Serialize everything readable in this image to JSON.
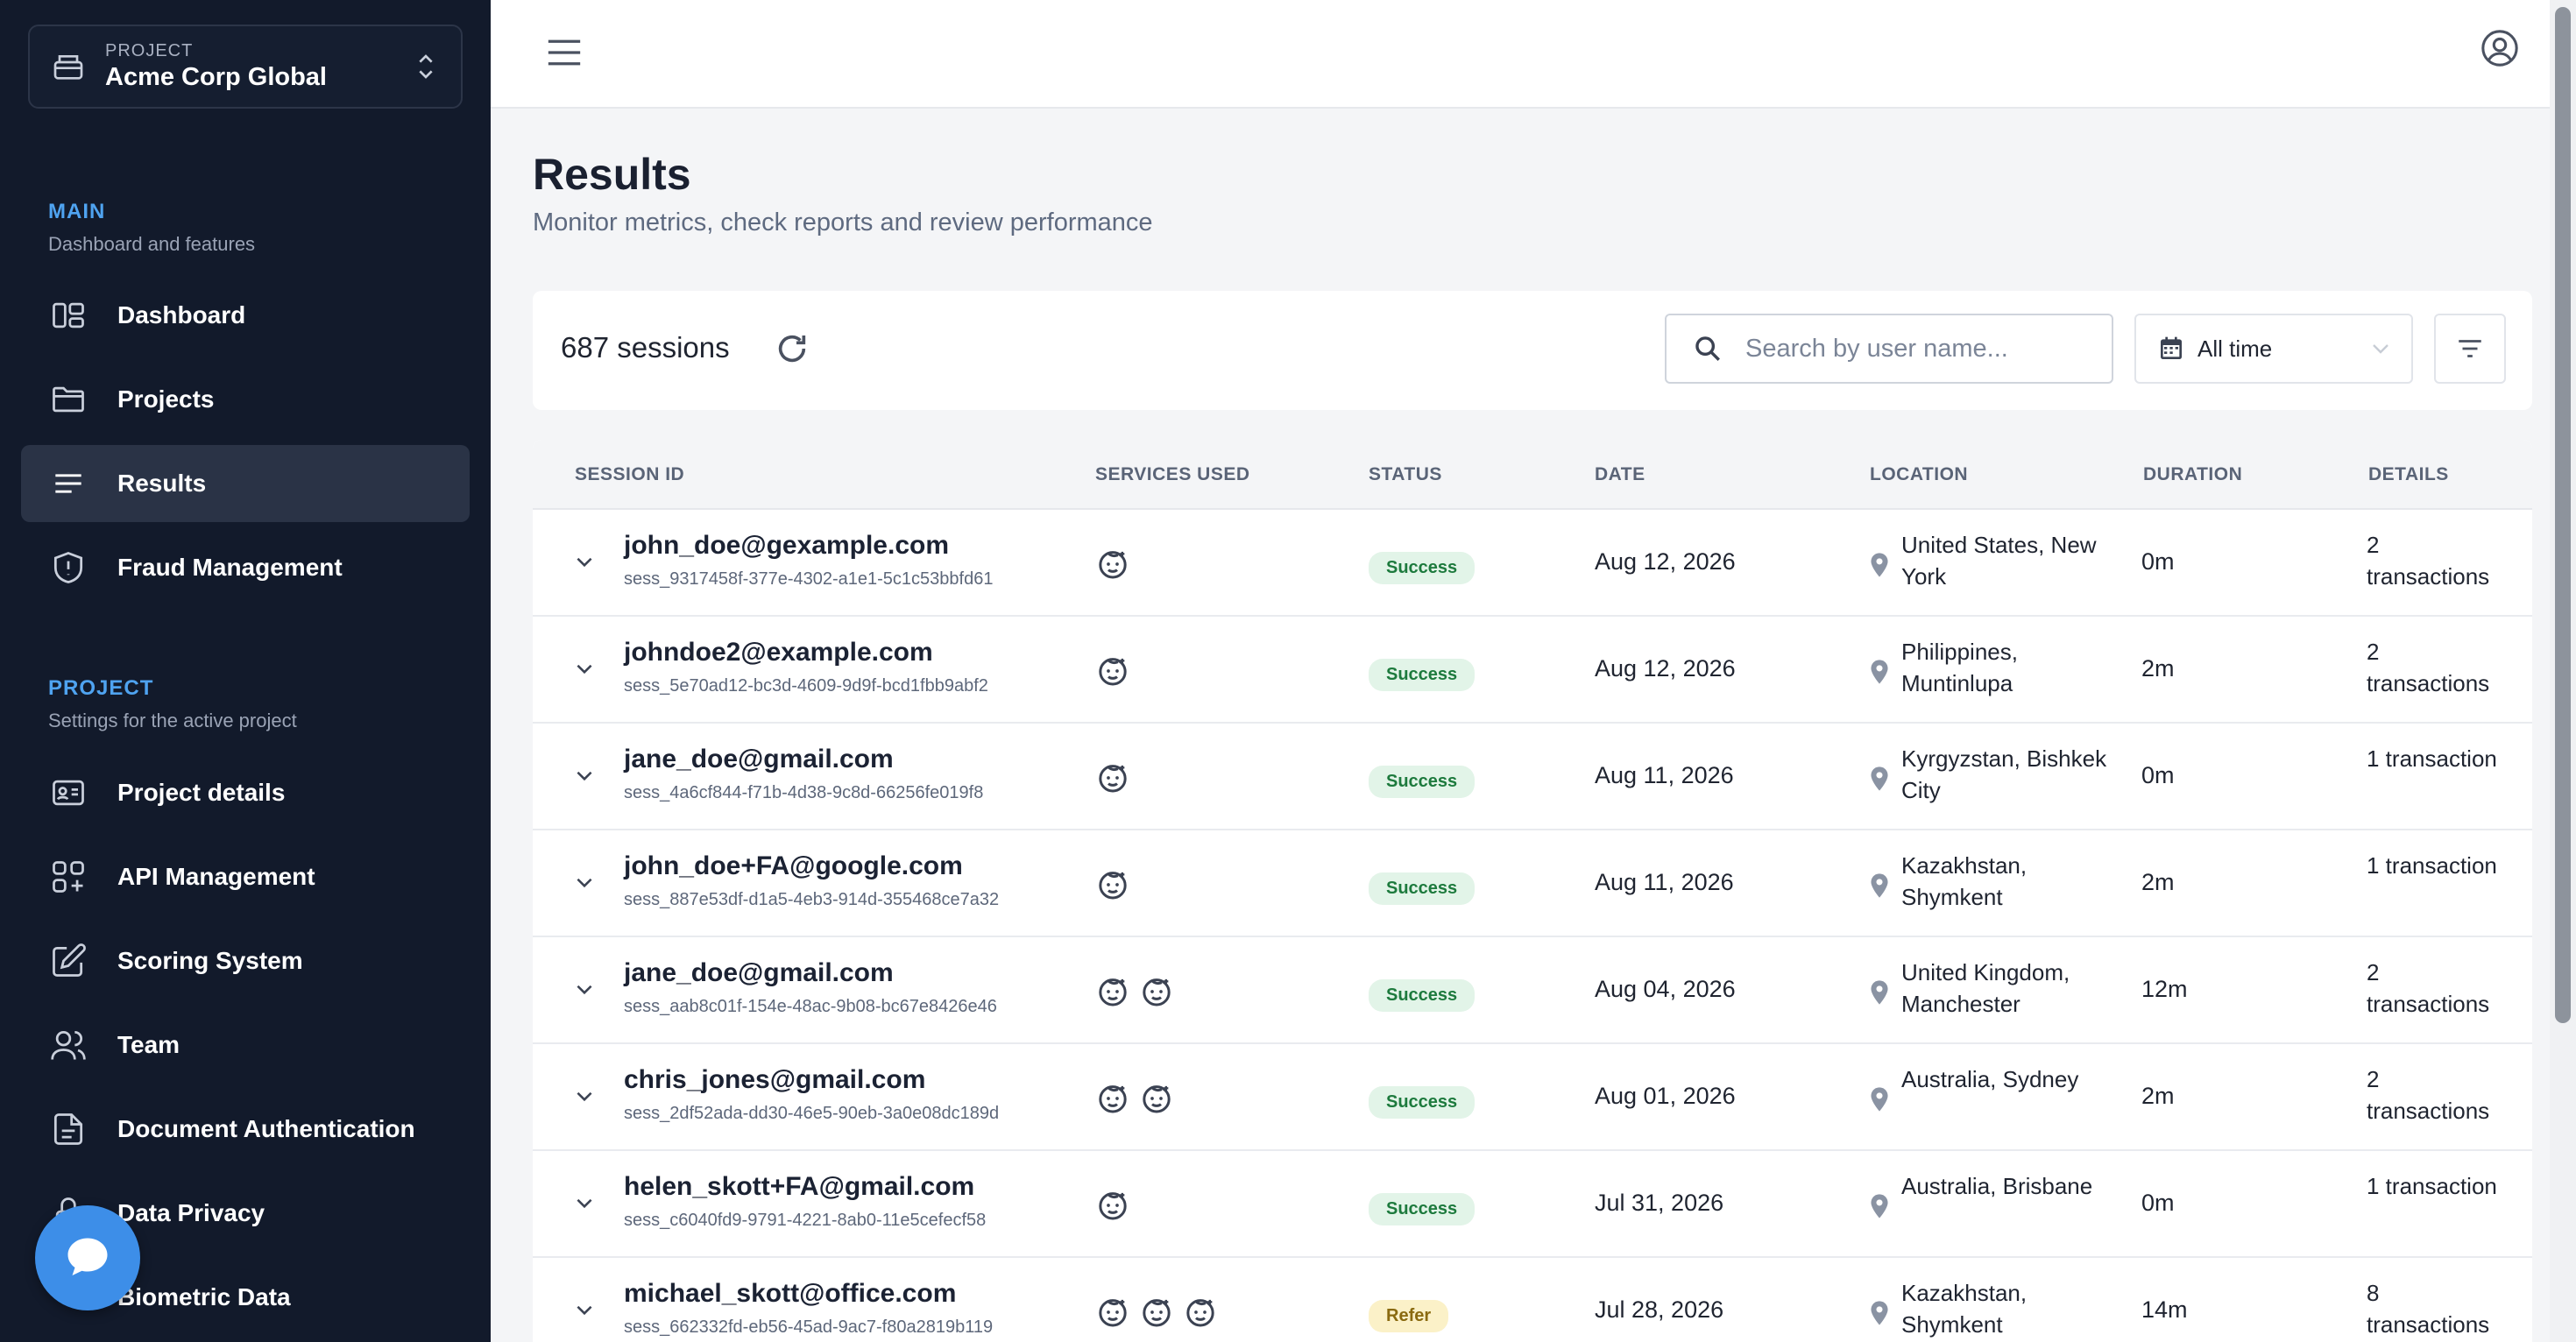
{
  "sidebar": {
    "project_label": "PROJECT",
    "project_name": "Acme Corp Global",
    "main_section": {
      "title": "MAIN",
      "subtitle": "Dashboard and features"
    },
    "main_items": [
      {
        "label": "Dashboard",
        "icon": "dashboard-icon"
      },
      {
        "label": "Projects",
        "icon": "folder-icon"
      },
      {
        "label": "Results",
        "icon": "list-icon",
        "active": true
      },
      {
        "label": "Fraud Management",
        "icon": "shield-icon"
      }
    ],
    "project_section": {
      "title": "PROJECT",
      "subtitle": "Settings for the active project"
    },
    "project_items": [
      {
        "label": "Project details",
        "icon": "id-card-icon"
      },
      {
        "label": "API Management",
        "icon": "api-grid-icon"
      },
      {
        "label": "Scoring System",
        "icon": "edit-icon"
      },
      {
        "label": "Team",
        "icon": "users-icon"
      },
      {
        "label": "Document Authentication",
        "icon": "document-icon"
      },
      {
        "label": "Data Privacy",
        "icon": "lock-icon"
      },
      {
        "label": "Biometric Data",
        "icon": "fingerprint-icon"
      }
    ]
  },
  "header": {
    "menu_icon": "hamburger-icon",
    "user_icon": "user-circle-icon"
  },
  "page": {
    "title": "Results",
    "subtitle": "Monitor metrics, check reports and review performance"
  },
  "toolbar": {
    "sessions_count": "687 sessions",
    "search_placeholder": "Search by user name...",
    "date_filter": "All time"
  },
  "table": {
    "columns": [
      "SESSION ID",
      "SERVICES USED",
      "STATUS",
      "DATE",
      "LOCATION",
      "DURATION",
      "DETAILS"
    ],
    "rows": [
      {
        "email": "john_doe@gexample.com",
        "session": "sess_9317458f-377e-4302-a1e1-5c1c53bbfd61",
        "services": 1,
        "status": "Success",
        "status_type": "success",
        "date": "Aug 12, 2026",
        "location": "United States, New York",
        "duration": "0m",
        "details": "2 transactions"
      },
      {
        "email": "johndoe2@example.com",
        "session": "sess_5e70ad12-bc3d-4609-9d9f-bcd1fbb9abf2",
        "services": 1,
        "status": "Success",
        "status_type": "success",
        "date": "Aug 12, 2026",
        "location": "Philippines, Muntinlupa",
        "duration": "2m",
        "details": "2 transactions"
      },
      {
        "email": "jane_doe@gmail.com",
        "session": "sess_4a6cf844-f71b-4d38-9c8d-66256fe019f8",
        "services": 1,
        "status": "Success",
        "status_type": "success",
        "date": "Aug 11, 2026",
        "location": "Kyrgyzstan, Bishkek City",
        "duration": "0m",
        "details": "1 transaction"
      },
      {
        "email": "john_doe+FA@google.com",
        "session": "sess_887e53df-d1a5-4eb3-914d-355468ce7a32",
        "services": 1,
        "status": "Success",
        "status_type": "success",
        "date": "Aug 11, 2026",
        "location": "Kazakhstan, Shymkent",
        "duration": "2m",
        "details": "1 transaction"
      },
      {
        "email": "jane_doe@gmail.com",
        "session": "sess_aab8c01f-154e-48ac-9b08-bc67e8426e46",
        "services": 2,
        "status": "Success",
        "status_type": "success",
        "date": "Aug 04, 2026",
        "location": "United Kingdom, Manchester",
        "duration": "12m",
        "details": "2 transactions"
      },
      {
        "email": "chris_jones@gmail.com",
        "session": "sess_2df52ada-dd30-46e5-90eb-3a0e08dc189d",
        "services": 2,
        "status": "Success",
        "status_type": "success",
        "date": "Aug 01, 2026",
        "location": "Australia, Sydney",
        "duration": "2m",
        "details": "2 transactions"
      },
      {
        "email": "helen_skott+FA@gmail.com",
        "session": "sess_c6040fd9-9791-4221-8ab0-11e5cefecf58",
        "services": 1,
        "status": "Success",
        "status_type": "success",
        "date": "Jul 31, 2026",
        "location": "Australia, Brisbane",
        "duration": "0m",
        "details": "1 transaction"
      },
      {
        "email": "michael_skott@office.com",
        "session": "sess_662332fd-eb56-45ad-9ac7-f80a2819b119",
        "services": 3,
        "status": "Refer",
        "status_type": "refer",
        "date": "Jul 28, 2026",
        "location": "Kazakhstan, Shymkent",
        "duration": "14m",
        "details": "8 transactions"
      }
    ]
  },
  "chat": {
    "icon": "chat-bubble-icon"
  }
}
